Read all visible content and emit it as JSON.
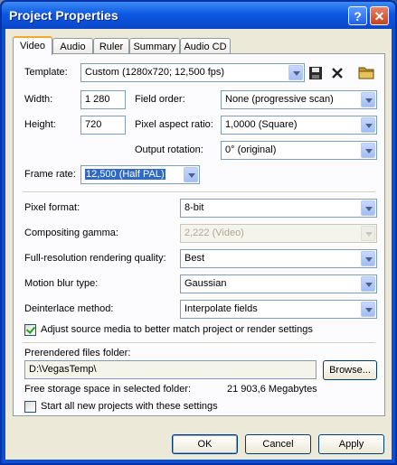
{
  "window": {
    "title": "Project Properties",
    "help": "?",
    "close": "✕"
  },
  "tabs": [
    "Video",
    "Audio",
    "Ruler",
    "Summary",
    "Audio CD"
  ],
  "video": {
    "template_label": "Template:",
    "template_value": "Custom (1280x720; 12,500 fps)",
    "width_label": "Width:",
    "width_value": "1 280",
    "height_label": "Height:",
    "height_value": "720",
    "field_order_label": "Field order:",
    "field_order_value": "None (progressive scan)",
    "pixel_aspect_label": "Pixel aspect ratio:",
    "pixel_aspect_value": "1,0000 (Square)",
    "output_rotation_label": "Output rotation:",
    "output_rotation_value": "0° (original)",
    "frame_rate_label": "Frame rate:",
    "frame_rate_value": "12,500 (Half PAL)",
    "pixel_format_label": "Pixel format:",
    "pixel_format_value": "8-bit",
    "compositing_gamma_label": "Compositing gamma:",
    "compositing_gamma_value": "2,222 (Video)",
    "rendering_quality_label": "Full-resolution rendering quality:",
    "rendering_quality_value": "Best",
    "motion_blur_label": "Motion blur type:",
    "motion_blur_value": "Gaussian",
    "deinterlace_label": "Deinterlace method:",
    "deinterlace_value": "Interpolate fields",
    "adjust_source_label": "Adjust source media to better match project or render settings",
    "adjust_source_checked": true,
    "prerendered_label": "Prerendered files folder:",
    "prerendered_value": "D:\\VegasTemp\\",
    "browse_label": "Browse...",
    "free_storage_label": "Free storage space in selected folder:",
    "free_storage_value": "21 903,6 Megabytes",
    "start_all_label": "Start all new projects with these settings",
    "start_all_checked": false
  },
  "buttons": {
    "ok": "OK",
    "cancel": "Cancel",
    "apply": "Apply"
  },
  "icons": {
    "save": "save-icon",
    "delete": "delete-icon",
    "folder": "folder-icon"
  }
}
